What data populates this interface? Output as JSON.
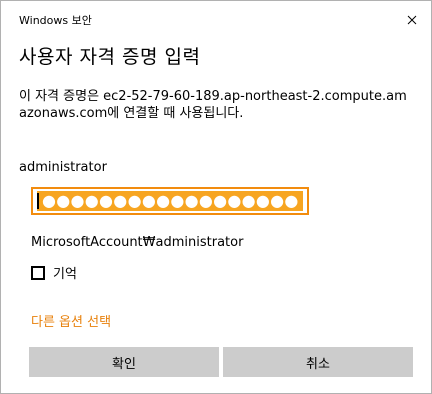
{
  "window": {
    "title": "Windows 보안"
  },
  "dialog": {
    "heading": "사용자 자격 증명 입력",
    "description": "이 자격 증명은 ec2-52-79-60-189.ap-northeast-2.compute.amazonaws.com에 연결할 때 사용됩니다.",
    "username": "administrator",
    "password_mask": "●●●●●●●●●●●●●●●●●●",
    "domain_user": "MicrosoftAccount₩administrator",
    "remember_label": "기억",
    "remember_checked": false,
    "more_options": "다른 옵션 선택",
    "ok_label": "확인",
    "cancel_label": "취소"
  },
  "colors": {
    "accent": "#f28c0e",
    "selection": "#f7a521",
    "button_bg": "#cccccc",
    "link": "#e8810c"
  },
  "icons": {
    "close": "close-icon"
  }
}
